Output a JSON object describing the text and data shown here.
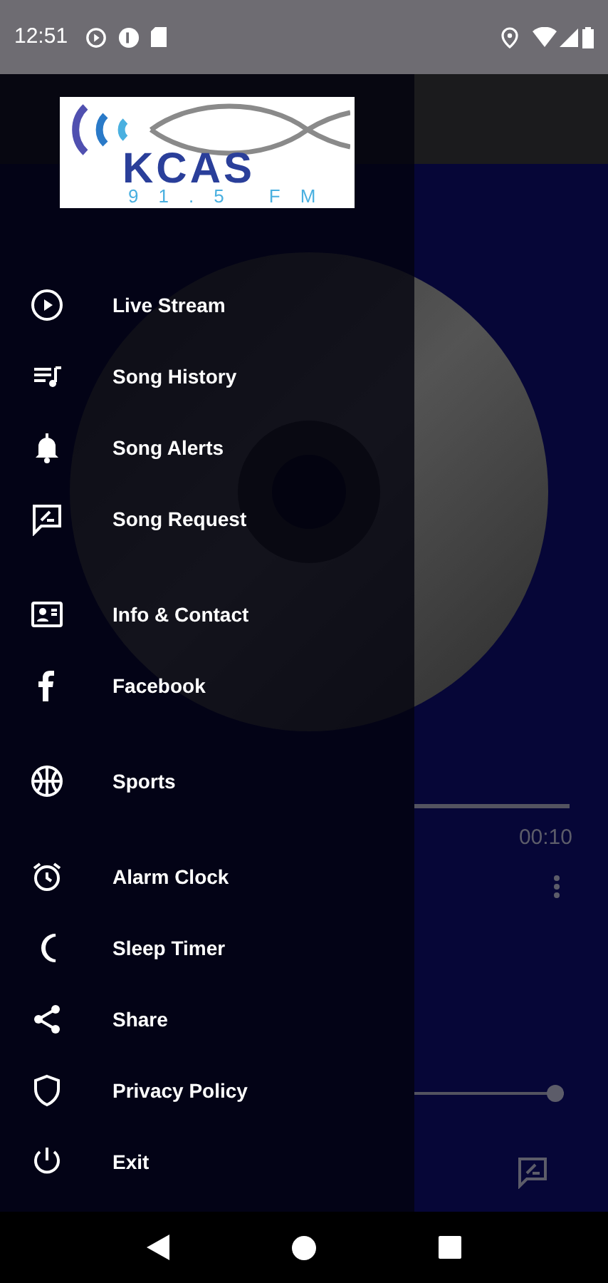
{
  "status_bar": {
    "time": "12:51"
  },
  "drawer": {
    "logo": {
      "name": "KCAS",
      "frequency": "91.5 FM"
    },
    "groups": [
      {
        "items": [
          {
            "label": "Live Stream"
          },
          {
            "label": "Song History"
          },
          {
            "label": "Song Alerts"
          },
          {
            "label": "Song Request"
          }
        ]
      },
      {
        "items": [
          {
            "label": "Info & Contact"
          },
          {
            "label": "Facebook"
          }
        ]
      },
      {
        "items": [
          {
            "label": "Sports"
          }
        ]
      },
      {
        "items": [
          {
            "label": "Alarm Clock"
          },
          {
            "label": "Sleep Timer"
          },
          {
            "label": "Share"
          },
          {
            "label": "Privacy Policy"
          },
          {
            "label": "Exit"
          }
        ]
      }
    ]
  },
  "player": {
    "time_right": "00:10",
    "volume": {
      "level": 1.0
    }
  }
}
